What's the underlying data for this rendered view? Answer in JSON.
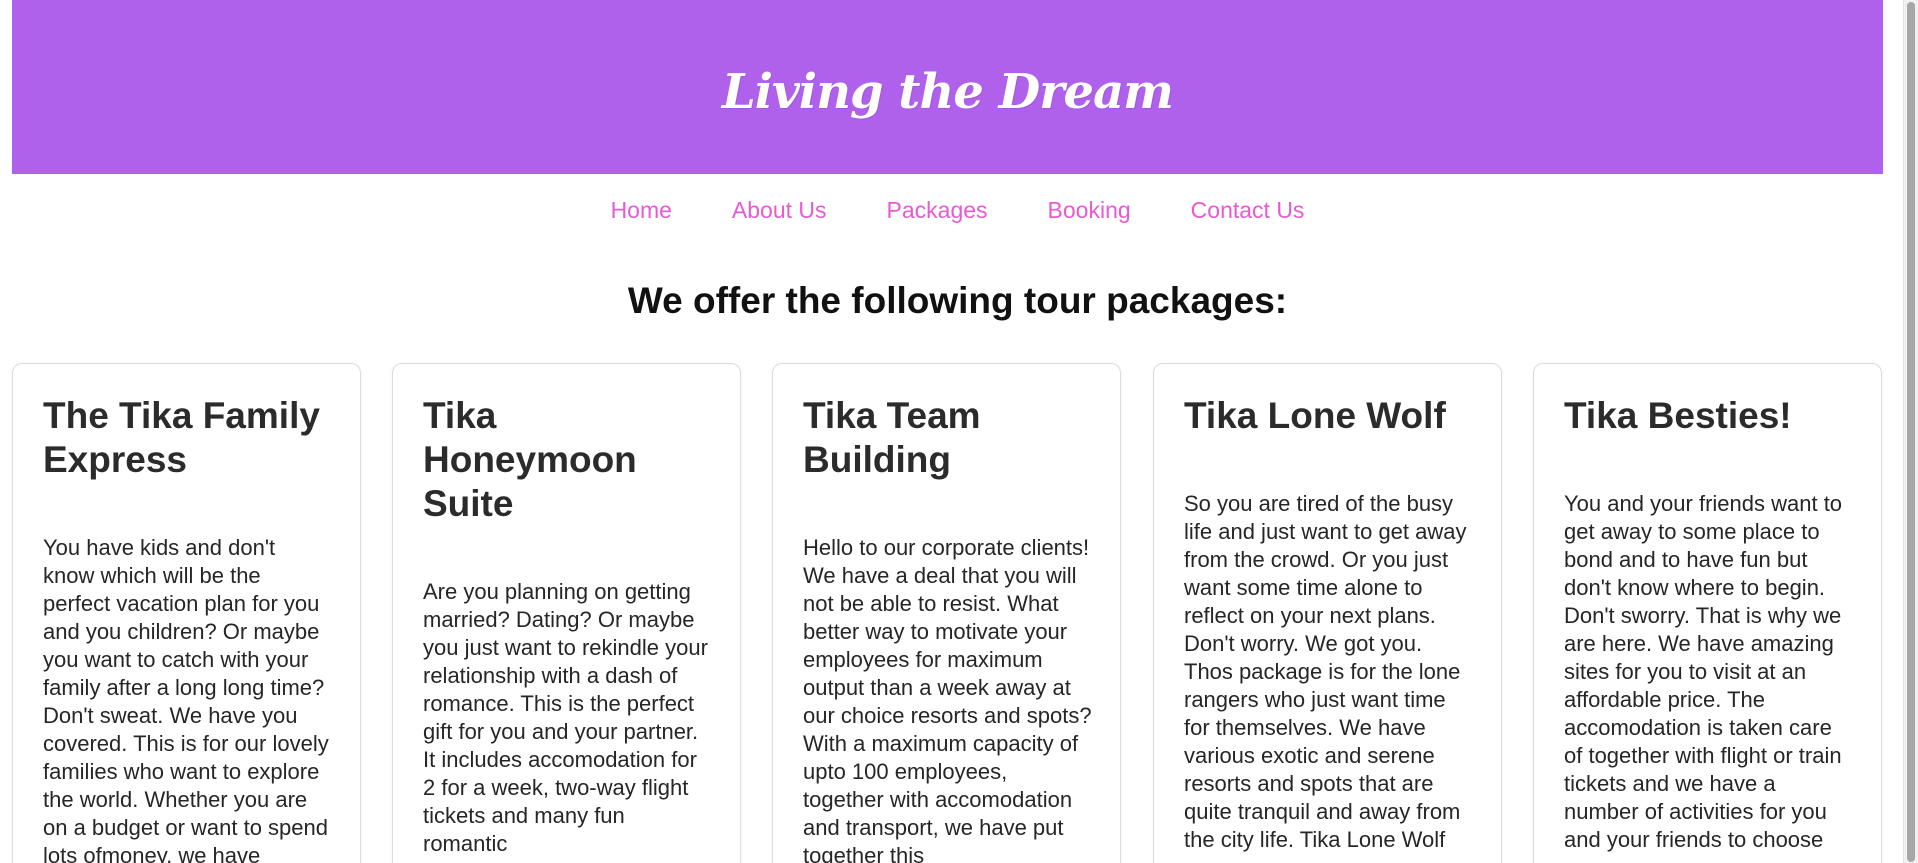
{
  "header": {
    "title": "Living the Dream",
    "background_color": "#b061ec"
  },
  "nav": {
    "items": [
      {
        "label": "Home"
      },
      {
        "label": "About Us"
      },
      {
        "label": "Packages"
      },
      {
        "label": "Booking"
      },
      {
        "label": "Contact Us"
      }
    ],
    "link_color": "#e75ad3"
  },
  "main": {
    "heading": "We offer the following tour packages:",
    "packages": [
      {
        "title": "The Tika Family Express",
        "description": "You have kids and don't know which will be the perfect vacation plan for you and you children? Or maybe you want to catch with your family after a long long time? Don't sweat. We have you covered. This is for our lovely families who want to explore the world. Whether you are on a budget or want to spend lots ofmoney, we have"
      },
      {
        "title": "Tika Honeymoon Suite",
        "description": "Are you planning on getting married? Dating? Or maybe you just want to rekindle your relationship with a dash of romance. This is the perfect gift for you and your partner. It includes accomodation for 2 for a week, two-way flight tickets and many fun romantic"
      },
      {
        "title": "Tika Team Building",
        "description": "Hello to our corporate clients! We have a deal that you will not be able to resist. What better way to motivate your employees for maximum output than a week away at our choice resorts and spots? With a maximum capacity of upto 100 employees, together with accomodation and transport, we have put together this"
      },
      {
        "title": "Tika Lone Wolf",
        "description": "So you are tired of the busy life and just want to get away from the crowd. Or you just want some time alone to reflect on your next plans. Don't worry. We got you. Thos package is for the lone rangers who just want time for themselves. We have various exotic and serene resorts and spots that are quite tranquil and away from the city life. Tika Lone Wolf"
      },
      {
        "title": "Tika Besties!",
        "description": "You and your friends want to get away to some place to bond and to have fun but don't know where to begin. Don't sworry. That is why we are here. We have amazing sites for you to visit at an affordable price. The accomodation is taken care of together with flight or train tickets and we have a number of activities for you and your friends to choose"
      }
    ]
  }
}
